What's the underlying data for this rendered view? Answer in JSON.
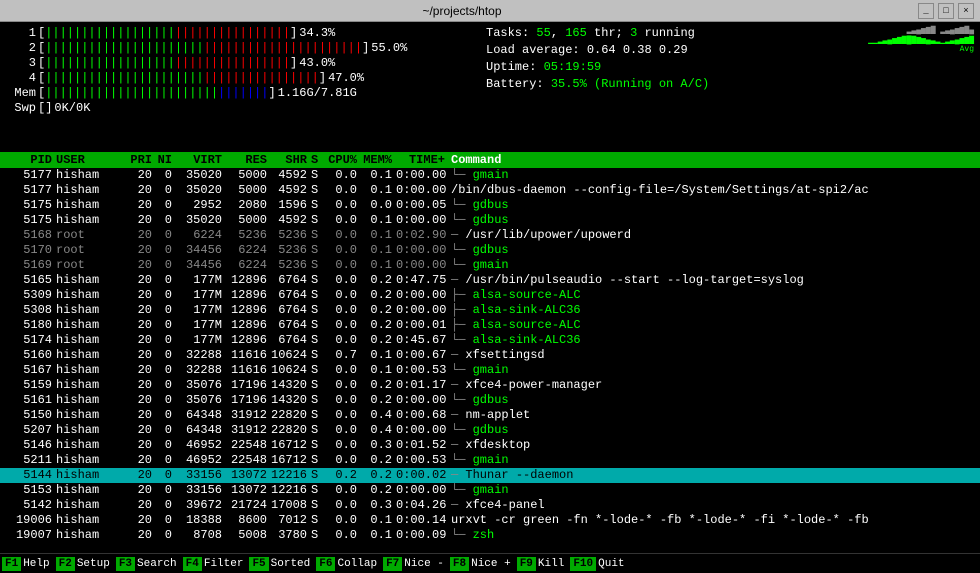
{
  "titlebar": {
    "title": "~/projects/htop",
    "min_label": "_",
    "max_label": "□",
    "close_label": "×"
  },
  "cpu_bars": [
    {
      "label": "1",
      "green_chars": "||||||||||||||||||",
      "red_chars": "||||||||||||||||",
      "percent": "34.3%"
    },
    {
      "label": "2",
      "green_chars": "||||||||||||||||||||||",
      "red_chars": "||||||||||||||||||||||",
      "percent": "55.0%"
    },
    {
      "label": "3",
      "green_chars": "||||||||||||||||||",
      "red_chars": "||||||||||||||||",
      "percent": "43.0%"
    },
    {
      "label": "4",
      "green_chars": "||||||||||||||||||||||",
      "red_chars": "||||||||||||||||",
      "percent": "47.0%"
    }
  ],
  "mem_bar": {
    "label": "Mem",
    "used": "1.16G",
    "total": "7.81G",
    "display": "1.16G/7.81G"
  },
  "swp_bar": {
    "label": "Swp",
    "used": "0K",
    "total": "0K",
    "display": "0K/0K"
  },
  "stats": {
    "tasks": "55",
    "threads": "165",
    "running": "3",
    "load1": "0.64",
    "load5": "0.38",
    "load15": "0.29",
    "uptime": "05:19:59",
    "battery": "35.5% (Running on A/C)"
  },
  "header": {
    "pid": "PID",
    "user": "USER",
    "pri": "PRI",
    "ni": "NI",
    "virt": "VIRT",
    "res": "RES",
    "shr": "SHR",
    "s": "S",
    "cpu": "CPU%",
    "mem": "MEM%",
    "time": "TIME+",
    "cmd": "Command"
  },
  "processes": [
    {
      "pid": "5177",
      "user": "hisham",
      "pri": "20",
      "ni": "0",
      "virt": "35020",
      "res": "5000",
      "shr": "4592",
      "s": "S",
      "cpu": "0.0",
      "mem": "0.1",
      "time": "0:00.00",
      "cmd": "gmain",
      "cmd_color": "green",
      "indent": "└─",
      "dimmed": false,
      "highlighted": false
    },
    {
      "pid": "5177",
      "user": "hisham",
      "pri": "20",
      "ni": "0",
      "virt": "35020",
      "res": "5000",
      "shr": "4592",
      "s": "S",
      "cpu": "0.0",
      "mem": "0.1",
      "time": "0:00.00",
      "cmd": "/bin/dbus-daemon --config-file=/System/Settings/at-spi2/ac",
      "cmd_color": "white",
      "indent": "",
      "dimmed": false,
      "highlighted": false
    },
    {
      "pid": "5175",
      "user": "hisham",
      "pri": "20",
      "ni": "0",
      "virt": "2952",
      "res": "2080",
      "shr": "1596",
      "s": "S",
      "cpu": "0.0",
      "mem": "0.0",
      "time": "0:00.05",
      "cmd": "gdbus",
      "cmd_color": "green",
      "indent": "└─",
      "dimmed": false,
      "highlighted": false
    },
    {
      "pid": "5175",
      "user": "hisham",
      "pri": "20",
      "ni": "0",
      "virt": "35020",
      "res": "5000",
      "shr": "4592",
      "s": "S",
      "cpu": "0.0",
      "mem": "0.1",
      "time": "0:00.00",
      "cmd": "gdbus",
      "cmd_color": "green",
      "indent": "└─",
      "dimmed": false,
      "highlighted": false
    },
    {
      "pid": "5168",
      "user": "root",
      "pri": "20",
      "ni": "0",
      "virt": "6224",
      "res": "5236",
      "shr": "5236",
      "s": "S",
      "cpu": "0.0",
      "mem": "0.1",
      "time": "0:02.90",
      "cmd": "/usr/lib/upower/upowerd",
      "cmd_color": "white",
      "indent": "─",
      "dimmed": true,
      "highlighted": false
    },
    {
      "pid": "5170",
      "user": "root",
      "pri": "20",
      "ni": "0",
      "virt": "34456",
      "res": "6224",
      "shr": "5236",
      "s": "S",
      "cpu": "0.0",
      "mem": "0.1",
      "time": "0:00.00",
      "cmd": "gdbus",
      "cmd_color": "green",
      "indent": "└─",
      "dimmed": true,
      "highlighted": false
    },
    {
      "pid": "5169",
      "user": "root",
      "pri": "20",
      "ni": "0",
      "virt": "34456",
      "res": "6224",
      "shr": "5236",
      "s": "S",
      "cpu": "0.0",
      "mem": "0.1",
      "time": "0:00.00",
      "cmd": "gmain",
      "cmd_color": "green",
      "indent": "└─",
      "dimmed": true,
      "highlighted": false
    },
    {
      "pid": "5165",
      "user": "hisham",
      "pri": "20",
      "ni": "0",
      "virt": "177M",
      "res": "12896",
      "shr": "6764",
      "s": "S",
      "cpu": "0.0",
      "mem": "0.2",
      "time": "0:47.75",
      "cmd": "/usr/bin/pulseaudio --start --log-target=syslog",
      "cmd_color": "white",
      "indent": "─",
      "dimmed": false,
      "highlighted": false
    },
    {
      "pid": "5309",
      "user": "hisham",
      "pri": "20",
      "ni": "0",
      "virt": "177M",
      "res": "12896",
      "shr": "6764",
      "s": "S",
      "cpu": "0.0",
      "mem": "0.2",
      "time": "0:00.00",
      "cmd": "alsa-source-ALC",
      "cmd_color": "green",
      "indent": "├─",
      "dimmed": false,
      "highlighted": false
    },
    {
      "pid": "5308",
      "user": "hisham",
      "pri": "20",
      "ni": "0",
      "virt": "177M",
      "res": "12896",
      "shr": "6764",
      "s": "S",
      "cpu": "0.0",
      "mem": "0.2",
      "time": "0:00.00",
      "cmd": "alsa-sink-ALC36",
      "cmd_color": "green",
      "indent": "├─",
      "dimmed": false,
      "highlighted": false
    },
    {
      "pid": "5180",
      "user": "hisham",
      "pri": "20",
      "ni": "0",
      "virt": "177M",
      "res": "12896",
      "shr": "6764",
      "s": "S",
      "cpu": "0.0",
      "mem": "0.2",
      "time": "0:00.01",
      "cmd": "alsa-source-ALC",
      "cmd_color": "green",
      "indent": "├─",
      "dimmed": false,
      "highlighted": false
    },
    {
      "pid": "5174",
      "user": "hisham",
      "pri": "20",
      "ni": "0",
      "virt": "177M",
      "res": "12896",
      "shr": "6764",
      "s": "S",
      "cpu": "0.0",
      "mem": "0.2",
      "time": "0:45.67",
      "cmd": "alsa-sink-ALC36",
      "cmd_color": "green",
      "indent": "└─",
      "dimmed": false,
      "highlighted": false
    },
    {
      "pid": "5160",
      "user": "hisham",
      "pri": "20",
      "ni": "0",
      "virt": "32288",
      "res": "11616",
      "shr": "10624",
      "s": "S",
      "cpu": "0.7",
      "mem": "0.1",
      "time": "0:00.67",
      "cmd": "xfsettingsd",
      "cmd_color": "white",
      "indent": "─",
      "dimmed": false,
      "highlighted": false
    },
    {
      "pid": "5167",
      "user": "hisham",
      "pri": "20",
      "ni": "0",
      "virt": "32288",
      "res": "11616",
      "shr": "10624",
      "s": "S",
      "cpu": "0.0",
      "mem": "0.1",
      "time": "0:00.53",
      "cmd": "gmain",
      "cmd_color": "green",
      "indent": "└─",
      "dimmed": false,
      "highlighted": false
    },
    {
      "pid": "5159",
      "user": "hisham",
      "pri": "20",
      "ni": "0",
      "virt": "35076",
      "res": "17196",
      "shr": "14320",
      "s": "S",
      "cpu": "0.0",
      "mem": "0.2",
      "time": "0:01.17",
      "cmd": "xfce4-power-manager",
      "cmd_color": "white",
      "indent": "─",
      "dimmed": false,
      "highlighted": false
    },
    {
      "pid": "5161",
      "user": "hisham",
      "pri": "20",
      "ni": "0",
      "virt": "35076",
      "res": "17196",
      "shr": "14320",
      "s": "S",
      "cpu": "0.0",
      "mem": "0.2",
      "time": "0:00.00",
      "cmd": "gdbus",
      "cmd_color": "green",
      "indent": "└─",
      "dimmed": false,
      "highlighted": false
    },
    {
      "pid": "5150",
      "user": "hisham",
      "pri": "20",
      "ni": "0",
      "virt": "64348",
      "res": "31912",
      "shr": "22820",
      "s": "S",
      "cpu": "0.0",
      "mem": "0.4",
      "time": "0:00.68",
      "cmd": "nm-applet",
      "cmd_color": "white",
      "indent": "─",
      "dimmed": false,
      "highlighted": false
    },
    {
      "pid": "5207",
      "user": "hisham",
      "pri": "20",
      "ni": "0",
      "virt": "64348",
      "res": "31912",
      "shr": "22820",
      "s": "S",
      "cpu": "0.0",
      "mem": "0.4",
      "time": "0:00.00",
      "cmd": "gdbus",
      "cmd_color": "green",
      "indent": "└─",
      "dimmed": false,
      "highlighted": false
    },
    {
      "pid": "5146",
      "user": "hisham",
      "pri": "20",
      "ni": "0",
      "virt": "46952",
      "res": "22548",
      "shr": "16712",
      "s": "S",
      "cpu": "0.0",
      "mem": "0.3",
      "time": "0:01.52",
      "cmd": "xfdesktop",
      "cmd_color": "white",
      "indent": "─",
      "dimmed": false,
      "highlighted": false
    },
    {
      "pid": "5211",
      "user": "hisham",
      "pri": "20",
      "ni": "0",
      "virt": "46952",
      "res": "22548",
      "shr": "16712",
      "s": "S",
      "cpu": "0.0",
      "mem": "0.2",
      "time": "0:00.53",
      "cmd": "gmain",
      "cmd_color": "green",
      "indent": "└─",
      "dimmed": false,
      "highlighted": false
    },
    {
      "pid": "5144",
      "user": "hisham",
      "pri": "20",
      "ni": "0",
      "virt": "33156",
      "res": "13072",
      "shr": "12216",
      "s": "S",
      "cpu": "0.2",
      "mem": "0.2",
      "time": "0:00.02",
      "cmd": "Thunar --daemon",
      "cmd_color": "cyan",
      "indent": "─",
      "dimmed": false,
      "highlighted": true
    },
    {
      "pid": "5153",
      "user": "hisham",
      "pri": "20",
      "ni": "0",
      "virt": "33156",
      "res": "13072",
      "shr": "12216",
      "s": "S",
      "cpu": "0.0",
      "mem": "0.2",
      "time": "0:00.00",
      "cmd": "gmain",
      "cmd_color": "green",
      "indent": "└─",
      "dimmed": false,
      "highlighted": false
    },
    {
      "pid": "5142",
      "user": "hisham",
      "pri": "20",
      "ni": "0",
      "virt": "39672",
      "res": "21724",
      "shr": "17008",
      "s": "S",
      "cpu": "0.0",
      "mem": "0.3",
      "time": "0:04.26",
      "cmd": "xfce4-panel",
      "cmd_color": "white",
      "indent": "─",
      "dimmed": false,
      "highlighted": false
    },
    {
      "pid": "19006",
      "user": "hisham",
      "pri": "20",
      "ni": "0",
      "virt": "18388",
      "res": "8600",
      "shr": "7012",
      "s": "S",
      "cpu": "0.0",
      "mem": "0.1",
      "time": "0:00.14",
      "cmd": "urxvt -cr green -fn *-lode-* -fb *-lode-* -fi *-lode-* -fb",
      "cmd_color": "white",
      "indent": "",
      "dimmed": false,
      "highlighted": false
    },
    {
      "pid": "19007",
      "user": "hisham",
      "pri": "20",
      "ni": "0",
      "virt": "8708",
      "res": "5008",
      "shr": "3780",
      "s": "S",
      "cpu": "0.0",
      "mem": "0.1",
      "time": "0:00.09",
      "cmd": "zsh",
      "cmd_color": "green",
      "indent": "└─",
      "dimmed": false,
      "highlighted": false
    }
  ],
  "bottom_bar": [
    {
      "fn": "F1",
      "label": "Help"
    },
    {
      "fn": "F2",
      "label": "Setup"
    },
    {
      "fn": "F3",
      "label": "Search"
    },
    {
      "fn": "F4",
      "label": "Filter"
    },
    {
      "fn": "F5",
      "label": "Sorted"
    },
    {
      "fn": "F6",
      "label": "Collap"
    },
    {
      "fn": "F7",
      "label": "Nice -"
    },
    {
      "fn": "F8",
      "label": "Nice +"
    },
    {
      "fn": "F9",
      "label": "Kill"
    },
    {
      "fn": "F10",
      "label": "Quit"
    }
  ]
}
